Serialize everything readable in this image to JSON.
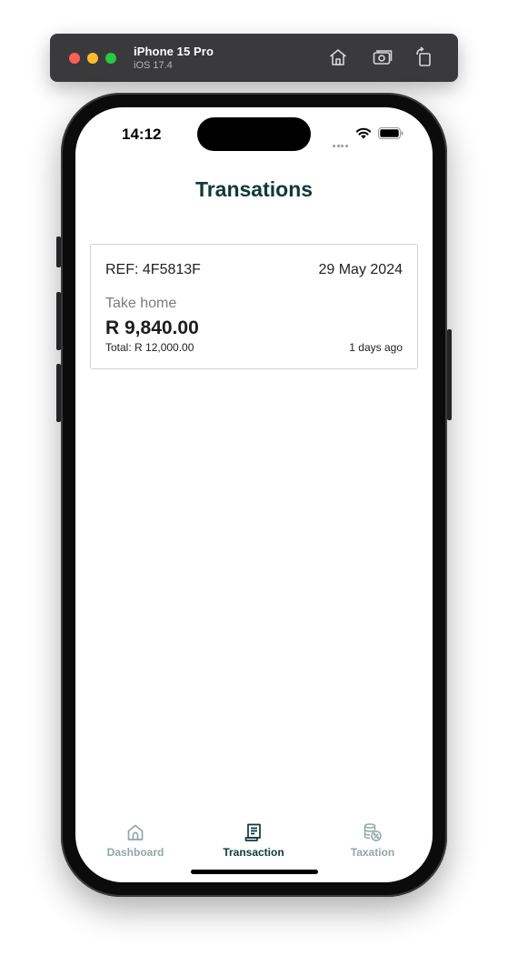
{
  "simulator": {
    "device_name": "iPhone 15 Pro",
    "os_version": "iOS 17.4",
    "icons": [
      "home-icon",
      "screenshot-icon",
      "rotate-icon"
    ]
  },
  "status_bar": {
    "time": "14:12",
    "icons": [
      "signal-icon",
      "wifi-icon",
      "battery-icon"
    ]
  },
  "page": {
    "title": "Transations"
  },
  "transactions": [
    {
      "ref": "REF: 4F5813F",
      "date": "29 May 2024",
      "label": "Take home",
      "amount": "R 9,840.00",
      "total": "Total: R 12,000.00",
      "relative_time": "1 days ago"
    }
  ],
  "tab_bar": {
    "active": "Transaction",
    "active_color": "#0f3a38",
    "inactive_color": "#93a6a6",
    "items": [
      {
        "label": "Dashboard",
        "icon": "home-icon"
      },
      {
        "label": "Transaction",
        "icon": "receipt-icon"
      },
      {
        "label": "Taxation",
        "icon": "coins-percent-icon"
      }
    ]
  }
}
